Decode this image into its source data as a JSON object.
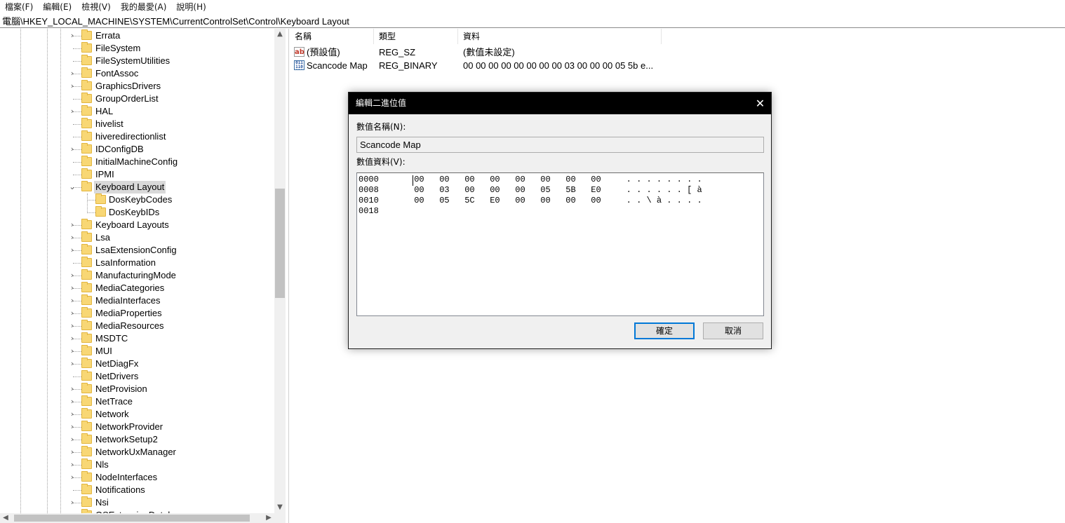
{
  "menubar": [
    "檔案(F)",
    "編輯(E)",
    "檢視(V)",
    "我的最愛(A)",
    "說明(H)"
  ],
  "address": "電腦\\HKEY_LOCAL_MACHINE\\SYSTEM\\CurrentControlSet\\Control\\Keyboard Layout",
  "tree": [
    {
      "label": "Errata",
      "expander": "closed"
    },
    {
      "label": "FileSystem",
      "expander": "none"
    },
    {
      "label": "FileSystemUtilities",
      "expander": "none"
    },
    {
      "label": "FontAssoc",
      "expander": "closed"
    },
    {
      "label": "GraphicsDrivers",
      "expander": "closed"
    },
    {
      "label": "GroupOrderList",
      "expander": "none"
    },
    {
      "label": "HAL",
      "expander": "closed"
    },
    {
      "label": "hivelist",
      "expander": "none"
    },
    {
      "label": "hiveredirectionlist",
      "expander": "none"
    },
    {
      "label": "IDConfigDB",
      "expander": "closed"
    },
    {
      "label": "InitialMachineConfig",
      "expander": "none"
    },
    {
      "label": "IPMI",
      "expander": "none"
    },
    {
      "label": "Keyboard Layout",
      "expander": "open",
      "selected": true
    },
    {
      "label": "DosKeybCodes",
      "expander": "none",
      "child": true
    },
    {
      "label": "DosKeybIDs",
      "expander": "none",
      "child": true
    },
    {
      "label": "Keyboard Layouts",
      "expander": "closed"
    },
    {
      "label": "Lsa",
      "expander": "closed"
    },
    {
      "label": "LsaExtensionConfig",
      "expander": "closed"
    },
    {
      "label": "LsaInformation",
      "expander": "none"
    },
    {
      "label": "ManufacturingMode",
      "expander": "closed"
    },
    {
      "label": "MediaCategories",
      "expander": "closed"
    },
    {
      "label": "MediaInterfaces",
      "expander": "closed"
    },
    {
      "label": "MediaProperties",
      "expander": "closed"
    },
    {
      "label": "MediaResources",
      "expander": "closed"
    },
    {
      "label": "MSDTC",
      "expander": "closed"
    },
    {
      "label": "MUI",
      "expander": "closed"
    },
    {
      "label": "NetDiagFx",
      "expander": "closed"
    },
    {
      "label": "NetDrivers",
      "expander": "none"
    },
    {
      "label": "NetProvision",
      "expander": "closed"
    },
    {
      "label": "NetTrace",
      "expander": "closed"
    },
    {
      "label": "Network",
      "expander": "closed"
    },
    {
      "label": "NetworkProvider",
      "expander": "closed"
    },
    {
      "label": "NetworkSetup2",
      "expander": "closed"
    },
    {
      "label": "NetworkUxManager",
      "expander": "closed"
    },
    {
      "label": "Nls",
      "expander": "closed"
    },
    {
      "label": "NodeInterfaces",
      "expander": "closed"
    },
    {
      "label": "Notifications",
      "expander": "none"
    },
    {
      "label": "Nsi",
      "expander": "closed"
    },
    {
      "label": "OSExtensionDatab",
      "expander": "closed"
    }
  ],
  "list": {
    "headers": [
      "名稱",
      "類型",
      "資料"
    ],
    "rows": [
      {
        "icon": "string-value-icon",
        "name": "(預設值)",
        "type": "REG_SZ",
        "data": "(數值未設定)"
      },
      {
        "icon": "binary-value-icon",
        "name": "Scancode Map",
        "type": "REG_BINARY",
        "data": "00 00 00 00 00 00 00 00 03 00 00 00 05 5b e..."
      }
    ]
  },
  "dialog": {
    "title": "編輯二進位值",
    "close_glyph": "✕",
    "name_label": "數值名稱(N):",
    "name_value": "Scancode Map",
    "data_label": "數值資料(V):",
    "hex_lines": [
      "0000       00   00   00   00   00   00   00   00     . . . . . . . .",
      "0008       00   03   00   00   00   05   5B   E0     . . . . . . [ à",
      "0010       00   05   5C   E0   00   00   00   00     . . \\ à . . . .",
      "0018"
    ],
    "ok_label": "確定",
    "cancel_label": "取消"
  }
}
